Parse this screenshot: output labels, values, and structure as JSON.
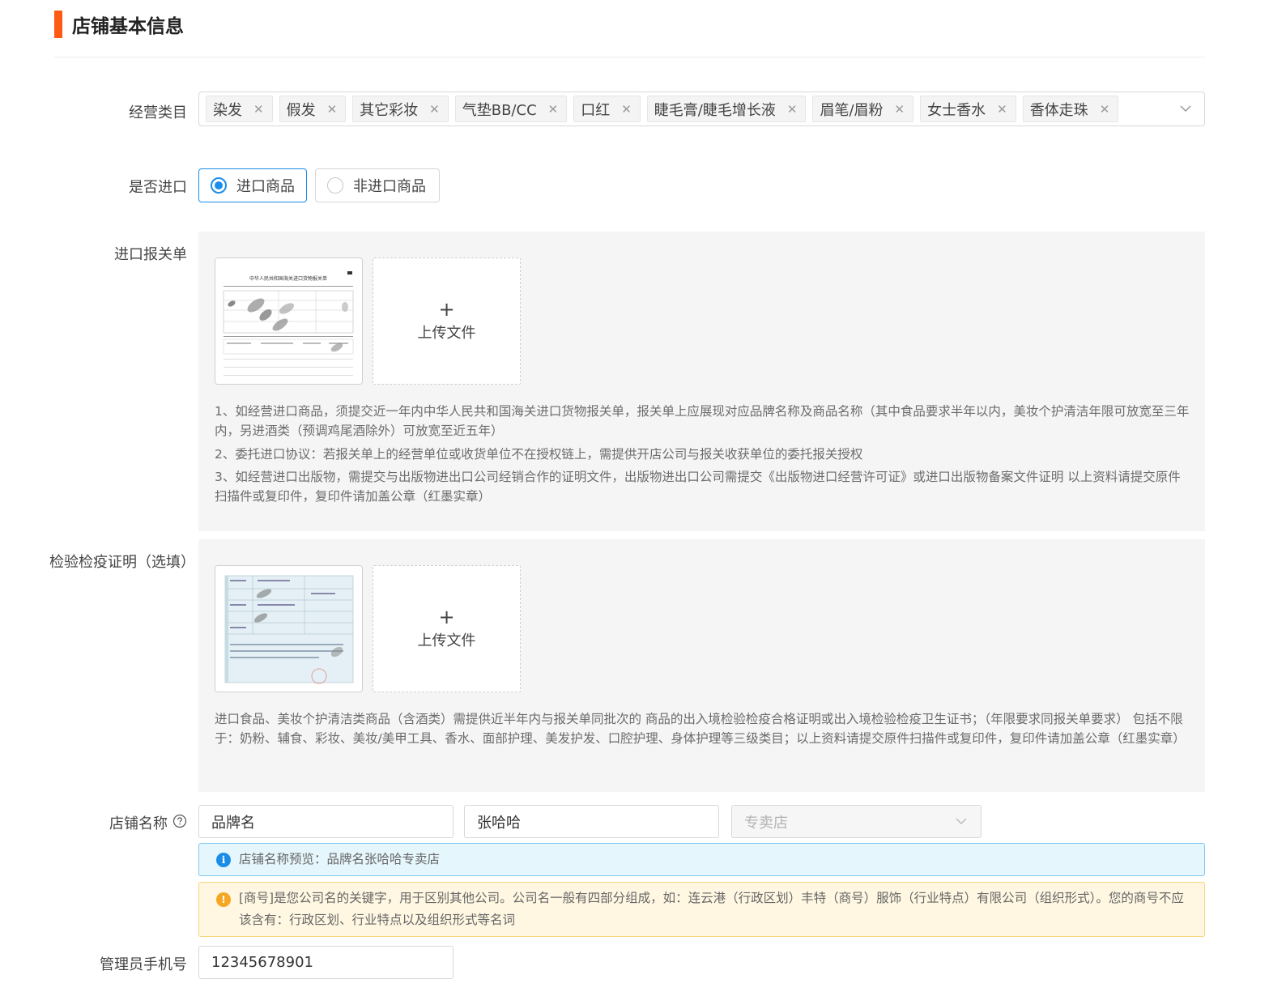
{
  "section": {
    "title": "店铺基本信息"
  },
  "business_category": {
    "label": "经营类目",
    "tags": [
      "染发",
      "假发",
      "其它彩妆",
      "气垫BB/CC",
      "口红",
      "睫毛膏/睫毛增长液",
      "眉笔/眉粉",
      "女士香水",
      "香体走珠"
    ],
    "remove_glyph": "✕"
  },
  "import": {
    "label": "是否进口",
    "options": [
      "进口商品",
      "非进口商品"
    ],
    "selected": "进口商品"
  },
  "customs": {
    "label": "进口报关单",
    "upload_plus": "+",
    "upload_text": "上传文件",
    "notes": [
      "1、如经营进口商品，须提交近一年内中华人民共和国海关进口货物报关单，报关单上应展现对应品牌名称及商品名称（其中食品要求半年以内，美妆个护清洁年限可放宽至三年内，另进酒类（预调鸡尾酒除外）可放宽至近五年）",
      "2、委托进口协议：若报关单上的经营单位或收货单位不在授权链上，需提供开店公司与报关收获单位的委托报关授权",
      "3、如经营进口出版物，需提交与出版物进出口公司经销合作的证明文件，出版物进出口公司需提交《出版物进口经营许可证》或进口出版物备案文件证明 以上资料请提交原件扫描件或复印件，复印件请加盖公章（红墨实章）"
    ],
    "thumb_caption": "中华人民共和国海关进口货物报关单"
  },
  "inspection": {
    "label": "检验检疫证明（选填）",
    "upload_plus": "+",
    "upload_text": "上传文件",
    "note": "进口食品、美妆个护清洁类商品（含酒类）需提供近半年内与报关单同批次的 商品的出入境检验检疫合格证明或出入境检验检疫卫生证书；（年限要求同报关单要求） 包括不限于：奶粉、辅食、彩妆、美妆/美甲工具、香水、面部护理、美发护发、口腔护理、身体护理等三级类目；以上资料请提交原件扫描件或复印件，复印件请加盖公章（红墨实章）"
  },
  "store_name": {
    "label": "店铺名称",
    "brand_value": "品牌名",
    "name_value": "张哈哈",
    "type_placeholder": "专卖店",
    "preview_text": "店铺名称预览：品牌名张哈哈专卖店",
    "info_glyph": "i",
    "warn_glyph": "!",
    "warning_text": "[商号]是您公司名的关键字，用于区别其他公司。公司名一般有四部分组成，如：连云港（行政区划）丰特（商号）服饰（行业特点）有限公司（组织形式）。您的商号不应该含有：行政区划、行业特点以及组织形式等名词"
  },
  "admin_phone": {
    "label": "管理员手机号",
    "value": "12345678901"
  },
  "colors": {
    "accent": "#ff5a13",
    "primary": "#1b8de8",
    "info_bg": "#e5f6fd",
    "warn_bg": "#fff7e2",
    "warn_icon": "#f5a623",
    "panel_bg": "#f5f5f6"
  }
}
